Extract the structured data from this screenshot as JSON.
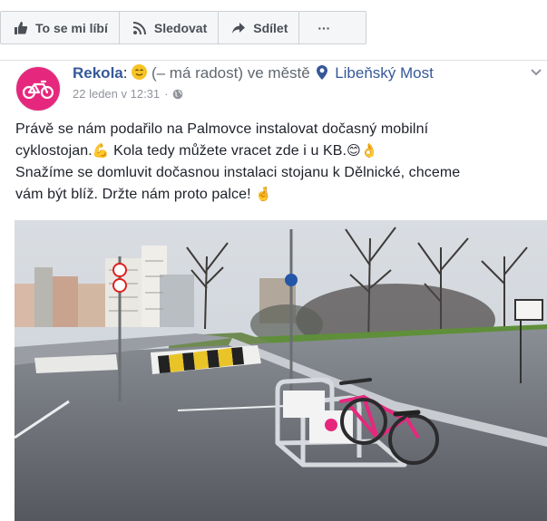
{
  "actions": {
    "like_label": "To se mi líbí",
    "follow_label": "Sledovat",
    "share_label": "Sdílet",
    "more_label": "···"
  },
  "post": {
    "page_name": "Rekola",
    "feeling_text": "(– má radost) ve městě",
    "place_name": "Libeňský Most",
    "timestamp": "22 leden v 12:31",
    "separator": "·",
    "menu_icon": "chevron-down-icon",
    "text_line1": "Právě se nám podařilo na Palmovce instalovat dočasný mobilní",
    "text_line2a": "cyklostojan.",
    "text_line2b": " Kola tedy můžete vracet zde i u KB.",
    "text_line3": "Snažíme se domluvit dočasnou instalaci stojanu k Dělnické, chceme",
    "text_line4": "vám být blíž. Držte nám proto palce!",
    "emoji_muscle": "💪",
    "emoji_smile": "😊",
    "emoji_ok": "👌",
    "emoji_crossed": "🤞"
  },
  "colors": {
    "brand_pink": "#e5287d",
    "link_blue": "#365899"
  }
}
